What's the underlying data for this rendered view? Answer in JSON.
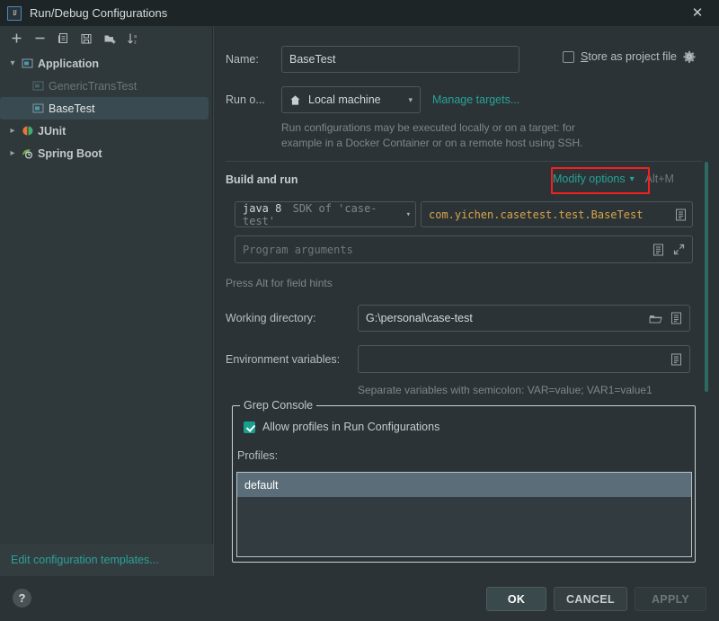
{
  "window": {
    "title": "Run/Debug Configurations",
    "app_icon": "intellij-idea-icon",
    "close_icon": "close-icon"
  },
  "toolbar": {
    "buttons": [
      {
        "name": "add-configuration-button",
        "icon": "plus-icon",
        "tooltip": "Add New Configuration"
      },
      {
        "name": "remove-configuration-button",
        "icon": "minus-icon",
        "tooltip": "Remove Configuration"
      },
      {
        "name": "copy-configuration-button",
        "icon": "copy-icon",
        "tooltip": "Copy Configuration"
      },
      {
        "name": "save-configuration-button",
        "icon": "save-icon",
        "tooltip": "Save Configuration"
      },
      {
        "name": "new-folder-button",
        "icon": "new-folder-icon",
        "tooltip": "Create New Folder"
      },
      {
        "name": "sort-configurations-button",
        "icon": "sort-alphabetically-icon",
        "tooltip": "Sort Configurations"
      }
    ]
  },
  "sidebar": {
    "tree": [
      {
        "label": "Application",
        "icon": "application-icon",
        "arrow": "chevron-down-icon",
        "level": 1,
        "bold": true,
        "selected": false,
        "dim": false
      },
      {
        "label": "GenericTransTest",
        "icon": "application-icon",
        "arrow": "",
        "level": 2,
        "bold": false,
        "selected": false,
        "dim": true
      },
      {
        "label": "BaseTest",
        "icon": "application-icon",
        "arrow": "",
        "level": 2,
        "bold": false,
        "selected": true,
        "dim": false
      },
      {
        "label": "JUnit",
        "icon": "junit-icon",
        "arrow": "chevron-right-icon",
        "level": 1,
        "bold": true,
        "selected": false,
        "dim": false
      },
      {
        "label": "Spring Boot",
        "icon": "spring-boot-icon",
        "arrow": "chevron-right-icon",
        "level": 1,
        "bold": true,
        "selected": false,
        "dim": false
      }
    ],
    "edit_templates_link": "Edit configuration templates..."
  },
  "form": {
    "name_label": "Name:",
    "name_value": "BaseTest",
    "store_as_project_file_label": "Store as project file",
    "store_as_project_file_checked": false,
    "store_gear_icon": "gear-icon",
    "run_on_label": "Run o...",
    "run_on_value": "Local machine",
    "run_on_icon": "local-machine-icon",
    "manage_targets_link": "Manage targets...",
    "run_on_hint_line1": "Run configurations may be executed locally or on a target: for",
    "run_on_hint_line2": "example in a Docker Container or on a remote host using SSH.",
    "build_and_run_title": "Build and run",
    "modify_options_link": "Modify options",
    "modify_options_arrow": "chevron-down-icon",
    "modify_options_shortcut": "Alt+M",
    "jre_value_prefix": "java 8",
    "jre_value_suffix": "SDK of 'case-test'",
    "main_class_value": "com.yichen.casetest.test.BaseTest",
    "main_class_browse_icon": "list-icon",
    "program_arguments_placeholder": "Program arguments",
    "program_arguments_value": "",
    "program_arguments_macro_icon": "list-icon",
    "program_arguments_expand_icon": "expand-icon",
    "field_hints_text": "Press Alt for field hints",
    "working_directory_label": "Working directory:",
    "working_directory_value": "G:\\personal\\case-test",
    "working_directory_browse_icon": "folder-icon",
    "working_directory_macro_icon": "list-icon",
    "environment_variables_label": "Environment variables:",
    "environment_variables_value": "",
    "environment_variables_browse_icon": "list-icon",
    "environment_variables_hint": "Separate variables with semicolon: VAR=value; VAR1=value1"
  },
  "grep_console": {
    "group_title": "Grep Console",
    "allow_profiles_label": "Allow profiles in Run Configurations",
    "allow_profiles_checked": true,
    "profiles_label": "Profiles:",
    "profiles": [
      "default"
    ]
  },
  "footer": {
    "help_label": "?",
    "ok_label": "OK",
    "cancel_label": "CANCEL",
    "apply_label": "APPLY"
  },
  "colors": {
    "accent_teal": "#2aa198",
    "highlight_red": "#f42020",
    "selection_blue": "#5a6d78",
    "code_amber": "#d9a54a",
    "window_bg": "#2b3336",
    "sidebar_bg": "#2f383b",
    "titlebar_bg": "#1e2527"
  },
  "annotation": {
    "highlight_target": "modify-options-link"
  }
}
